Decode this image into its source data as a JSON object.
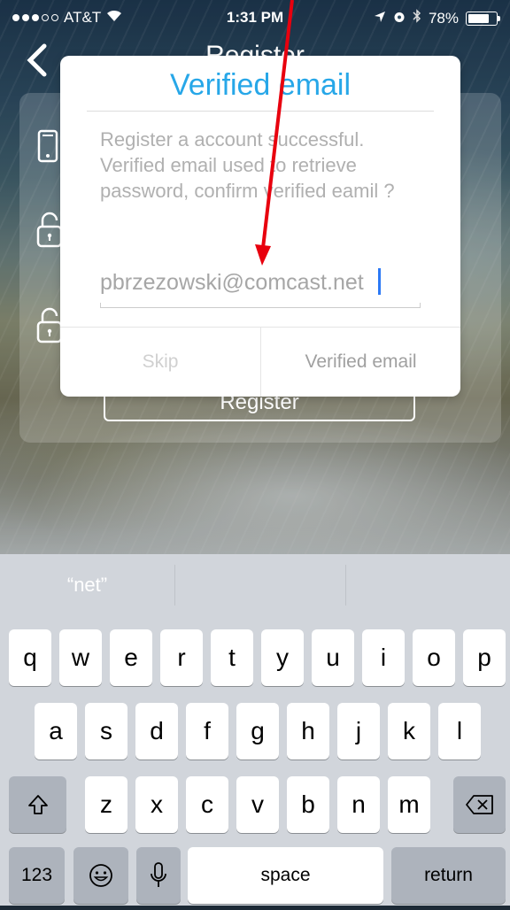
{
  "status_bar": {
    "carrier": "AT&T",
    "time": "1:31 PM",
    "battery": "78%",
    "battery_level": 0.78
  },
  "header": {
    "title": "Register",
    "back_icon": "chevron-left-icon"
  },
  "form": {
    "fields": [
      {
        "icon": "phone-icon"
      },
      {
        "icon": "lock-icon"
      },
      {
        "icon": "lock-icon"
      }
    ],
    "register_label": "Register"
  },
  "dialog": {
    "title": "Verified email",
    "message": "Register a account successful. Verified email used to retrieve password, confirm verified eamil ?",
    "email_value": "pbrzezowski@comcast.net",
    "skip_label": "Skip",
    "verify_label": "Verified email",
    "accent_color": "#27a7e8"
  },
  "keyboard": {
    "suggestions": [
      "“net”",
      "",
      ""
    ],
    "row1": [
      "q",
      "w",
      "e",
      "r",
      "t",
      "y",
      "u",
      "i",
      "o",
      "p"
    ],
    "row2": [
      "a",
      "s",
      "d",
      "f",
      "g",
      "h",
      "j",
      "k",
      "l"
    ],
    "row3": [
      "z",
      "x",
      "c",
      "v",
      "b",
      "n",
      "m"
    ],
    "numbers_label": "123",
    "space_label": "space",
    "return_label": "return",
    "shift_icon": "shift-icon",
    "delete_icon": "backspace-icon",
    "emoji_icon": "emoji-icon",
    "mic_icon": "microphone-icon"
  },
  "annotation": {
    "arrow_color": "#e8000e"
  }
}
